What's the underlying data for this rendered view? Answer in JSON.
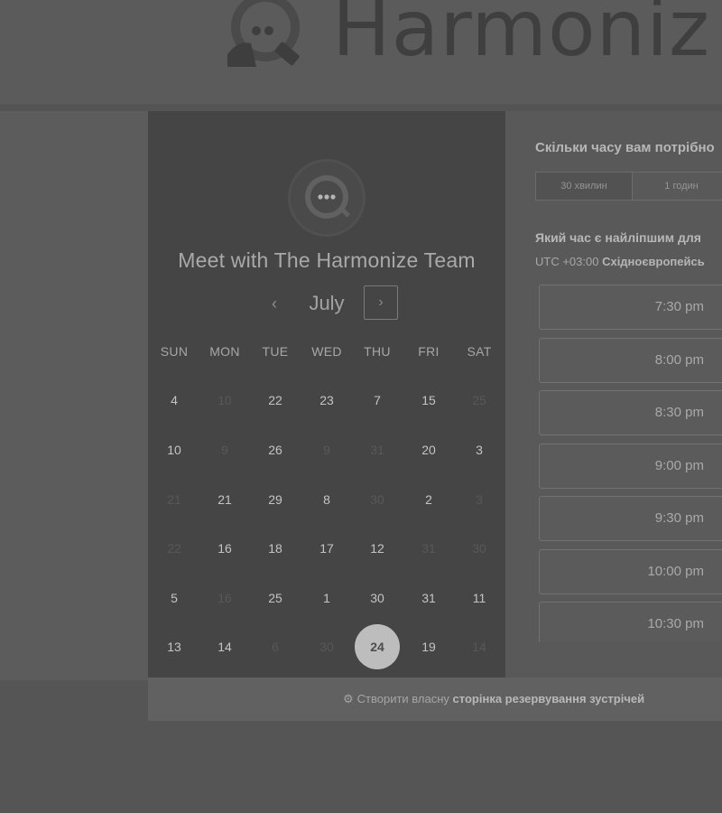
{
  "brand": {
    "name": "Harmoniz"
  },
  "meeting": {
    "title": "Meet with The Harmonize Team"
  },
  "calendar": {
    "month": "July",
    "prev_icon": "‹",
    "next_icon": "›",
    "weekdays": [
      "SUN",
      "MON",
      "TUE",
      "WED",
      "THU",
      "FRI",
      "SAT"
    ],
    "rows": [
      [
        {
          "d": "4",
          "on": true
        },
        {
          "d": "10",
          "on": false
        },
        {
          "d": "22",
          "on": true
        },
        {
          "d": "23",
          "on": true
        },
        {
          "d": "7",
          "on": true
        },
        {
          "d": "15",
          "on": true
        },
        {
          "d": "25",
          "on": false
        }
      ],
      [
        {
          "d": "10",
          "on": true
        },
        {
          "d": "9",
          "on": false
        },
        {
          "d": "26",
          "on": true
        },
        {
          "d": "9",
          "on": false
        },
        {
          "d": "31",
          "on": false
        },
        {
          "d": "20",
          "on": true
        },
        {
          "d": "3",
          "on": true
        }
      ],
      [
        {
          "d": "21",
          "on": false
        },
        {
          "d": "21",
          "on": true
        },
        {
          "d": "29",
          "on": true
        },
        {
          "d": "8",
          "on": true
        },
        {
          "d": "30",
          "on": false
        },
        {
          "d": "2",
          "on": true
        },
        {
          "d": "3",
          "on": false
        }
      ],
      [
        {
          "d": "22",
          "on": false
        },
        {
          "d": "16",
          "on": true
        },
        {
          "d": "18",
          "on": true
        },
        {
          "d": "17",
          "on": true
        },
        {
          "d": "12",
          "on": true
        },
        {
          "d": "31",
          "on": false
        },
        {
          "d": "30",
          "on": false
        }
      ],
      [
        {
          "d": "5",
          "on": true
        },
        {
          "d": "16",
          "on": false
        },
        {
          "d": "25",
          "on": true
        },
        {
          "d": "1",
          "on": true
        },
        {
          "d": "30",
          "on": true
        },
        {
          "d": "31",
          "on": true
        },
        {
          "d": "11",
          "on": true
        }
      ],
      [
        {
          "d": "13",
          "on": true
        },
        {
          "d": "14",
          "on": true
        },
        {
          "d": "6",
          "on": false
        },
        {
          "d": "30",
          "on": false
        },
        {
          "d": "24",
          "on": true,
          "selected": true
        },
        {
          "d": "19",
          "on": true
        },
        {
          "d": "14",
          "on": false
        }
      ]
    ]
  },
  "duration": {
    "question": "Скільки часу вам потрібно",
    "options": [
      {
        "label": "30 хвилин",
        "active": true
      },
      {
        "label": "1 годин",
        "active": false
      }
    ]
  },
  "times": {
    "question": "Який час є найліпшим для",
    "tz_offset": "UTC +03:00",
    "tz_name": "Східноєвропейсь",
    "slots": [
      "7:30 pm",
      "8:00 pm",
      "8:30 pm",
      "9:00 pm",
      "9:30 pm",
      "10:00 pm",
      "10:30 pm"
    ]
  },
  "footer": {
    "icon": "sprocket-icon",
    "prefix": "Створити власну",
    "link": "сторінка резервування зустрічей"
  }
}
